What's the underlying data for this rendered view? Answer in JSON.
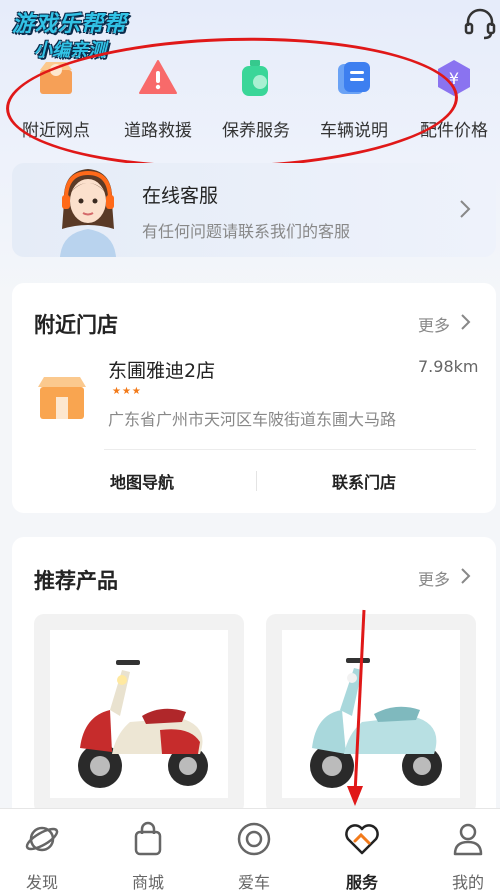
{
  "watermark": {
    "line1": "游戏乐帮帮",
    "line2": "小编亲测"
  },
  "quick_actions": [
    {
      "label": "附近网点",
      "icon": "shop-icon"
    },
    {
      "label": "道路救援",
      "icon": "warning-icon"
    },
    {
      "label": "保养服务",
      "icon": "maintenance-icon"
    },
    {
      "label": "车辆说明",
      "icon": "manual-icon"
    },
    {
      "label": "配件价格",
      "icon": "price-icon"
    }
  ],
  "customer_service": {
    "title": "在线客服",
    "subtitle": "有任何问题请联系我们的客服"
  },
  "nearby": {
    "title": "附近门店",
    "more": "更多",
    "store": {
      "name": "东圃雅迪2店",
      "rating": "★★★",
      "address": "广东省广州市天河区车陂街道东圃大马路",
      "distance": "7.98km"
    },
    "actions": {
      "navigate": "地图导航",
      "contact": "联系门店"
    }
  },
  "recommend": {
    "title": "推荐产品",
    "more": "更多"
  },
  "tabs": [
    {
      "label": "发现",
      "icon": "planet-icon"
    },
    {
      "label": "商城",
      "icon": "bag-icon"
    },
    {
      "label": "爱车",
      "icon": "target-icon"
    },
    {
      "label": "服务",
      "icon": "heart-handshake-icon",
      "active": true
    },
    {
      "label": "我的",
      "icon": "person-icon"
    }
  ],
  "colors": {
    "annotation": "#e01818",
    "accent": "#f27a1a",
    "watermark": "#32c3e6"
  }
}
